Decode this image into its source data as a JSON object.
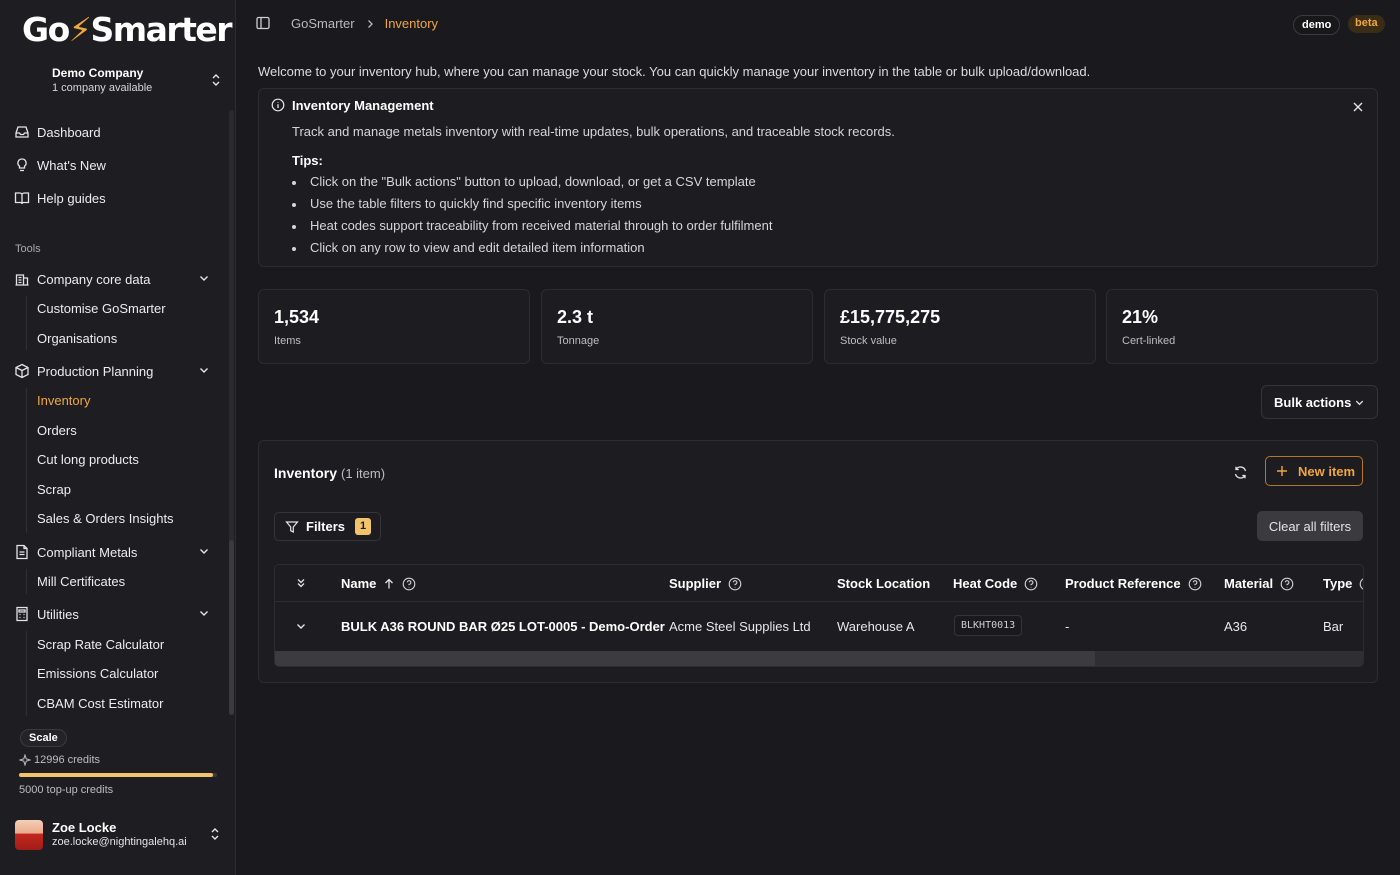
{
  "app": {
    "logo_text_pre": "Go",
    "logo_bolt": "⚡",
    "logo_text_post": "Smarter",
    "accent_color": "#f2a73a"
  },
  "company": {
    "name": "Demo Company",
    "subtitle": "1 company available"
  },
  "sidebar": {
    "top_items": [
      {
        "label": "Dashboard",
        "icon": "inbox-icon"
      },
      {
        "label": "What's New",
        "icon": "lightbulb-icon"
      },
      {
        "label": "Help guides",
        "icon": "book-open-icon"
      }
    ],
    "section_label": "Tools",
    "groups": [
      {
        "label": "Company core data",
        "icon": "building-icon",
        "items": [
          "Customise GoSmarter",
          "Organisations"
        ]
      },
      {
        "label": "Production Planning",
        "icon": "package-icon",
        "items": [
          "Inventory",
          "Orders",
          "Cut long products",
          "Scrap",
          "Sales & Orders Insights"
        ]
      },
      {
        "label": "Compliant Metals",
        "icon": "file-text-icon",
        "items": [
          "Mill Certificates"
        ]
      },
      {
        "label": "Utilities",
        "icon": "calculator-icon",
        "items": [
          "Scrap Rate Calculator",
          "Emissions Calculator",
          "CBAM Cost Estimator"
        ]
      }
    ],
    "active_item": "Inventory"
  },
  "plan": {
    "name": "Scale",
    "credits": "12996 credits",
    "credits_fraction": 0.98,
    "topup": "5000 top-up credits"
  },
  "user": {
    "name": "Zoe Locke",
    "email": "zoe.locke@nightingalehq.ai"
  },
  "breadcrumb": {
    "root": "GoSmarter",
    "current": "Inventory"
  },
  "badges": {
    "demo": "demo",
    "beta": "beta"
  },
  "welcome": "Welcome to your inventory hub, where you can manage your stock. You can quickly manage your inventory in the table or bulk upload/download.",
  "info": {
    "title": "Inventory Management",
    "description": "Track and manage metals inventory with real-time updates, bulk operations, and traceable stock records.",
    "tips_label": "Tips:",
    "tips": [
      "Click on the \"Bulk actions\" button to upload, download, or get a CSV template",
      "Use the table filters to quickly find specific inventory items",
      "Heat codes support traceability from received material through to order fulfilment",
      "Click on any row to view and edit detailed item information"
    ]
  },
  "stats": [
    {
      "value": "1,534",
      "label": "Items"
    },
    {
      "value": "2.3 t",
      "label": "Tonnage"
    },
    {
      "value": "£15,775,275",
      "label": "Stock value"
    },
    {
      "value": "21%",
      "label": "Cert-linked"
    }
  ],
  "bulk_actions_label": "Bulk actions",
  "inventory": {
    "title": "Inventory",
    "count": "(1 item)",
    "new_item_label": "New item",
    "filters_label": "Filters",
    "filters_count": "1",
    "clear_filters_label": "Clear all filters",
    "columns": [
      "Name",
      "Supplier",
      "Stock Location",
      "Heat Code",
      "Product Reference",
      "Material",
      "Type"
    ],
    "rows": [
      {
        "name": "BULK A36 ROUND BAR Ø25 LOT-0005 - Demo-Order",
        "supplier": "Acme Steel Supplies Ltd",
        "location": "Warehouse A",
        "heat_code": "BLKHT0013",
        "product_reference": "-",
        "material": "A36",
        "type": "Bar"
      }
    ]
  }
}
